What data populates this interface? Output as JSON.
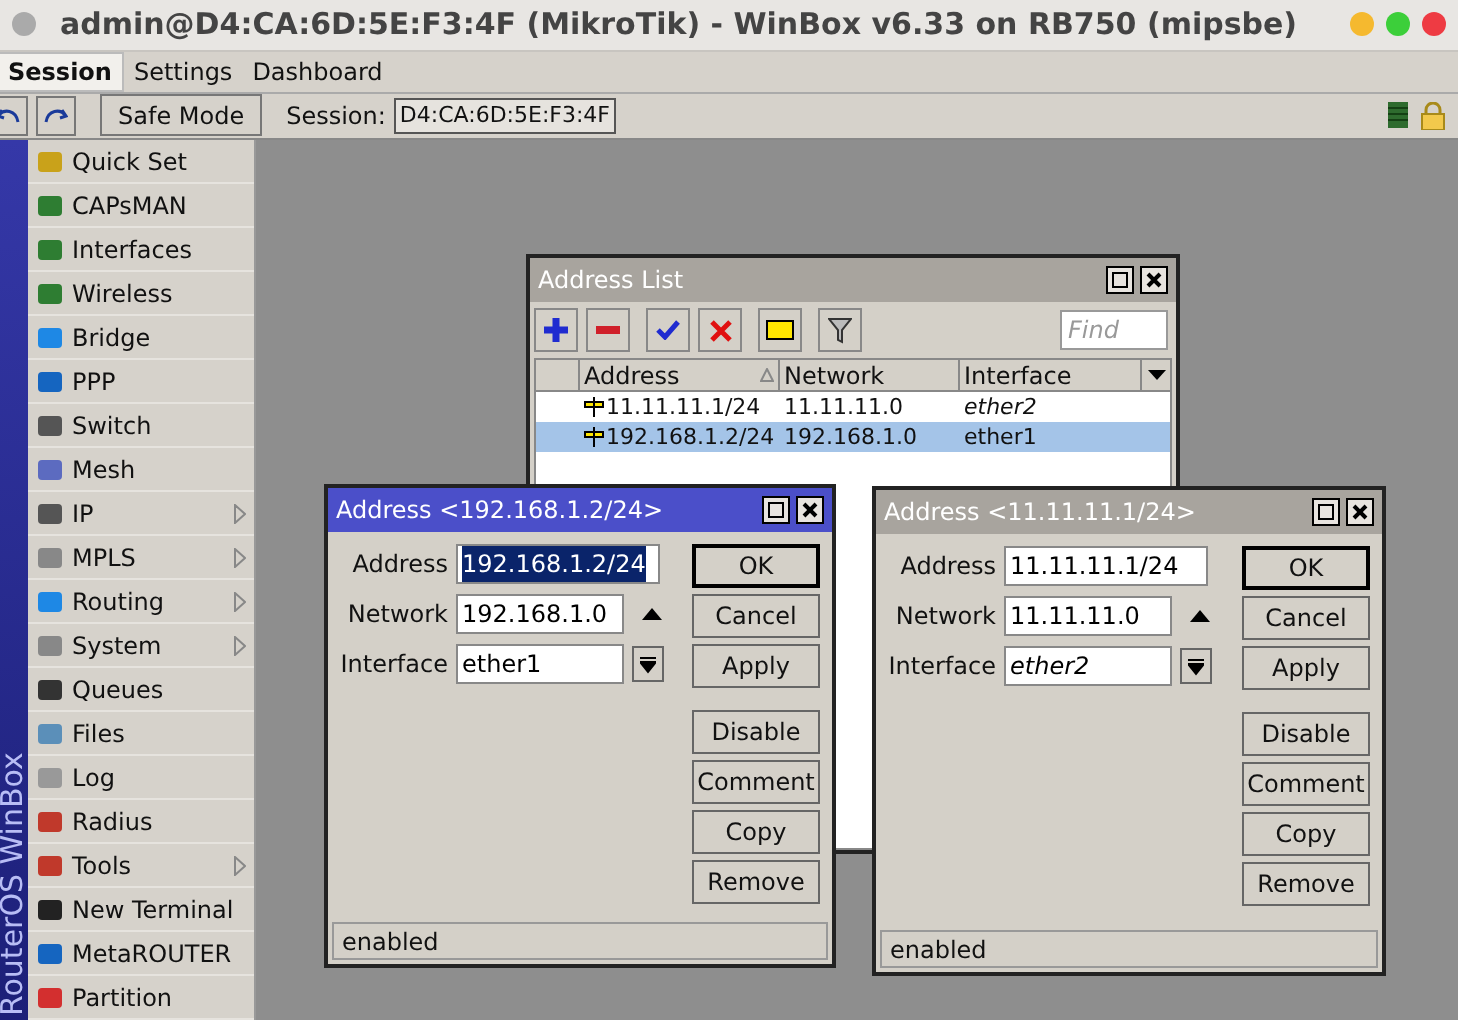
{
  "window": {
    "title": "admin@D4:CA:6D:5E:F3:4F (MikroTik) - WinBox v6.33 on RB750 (mipsbe)"
  },
  "menu": [
    {
      "label": "Session",
      "selected": true
    },
    {
      "label": "Settings",
      "selected": false
    },
    {
      "label": "Dashboard",
      "selected": false
    }
  ],
  "toolbar": {
    "safe_mode": "Safe Mode",
    "session_label": "Session:",
    "session_value": "D4:CA:6D:5E:F3:4F"
  },
  "sidebar": {
    "brand": "RouterOS WinBox",
    "items": [
      {
        "label": "Quick Set",
        "submenu": false
      },
      {
        "label": "CAPsMAN",
        "submenu": false
      },
      {
        "label": "Interfaces",
        "submenu": false
      },
      {
        "label": "Wireless",
        "submenu": false
      },
      {
        "label": "Bridge",
        "submenu": false
      },
      {
        "label": "PPP",
        "submenu": false
      },
      {
        "label": "Switch",
        "submenu": false
      },
      {
        "label": "Mesh",
        "submenu": false
      },
      {
        "label": "IP",
        "submenu": true
      },
      {
        "label": "MPLS",
        "submenu": true
      },
      {
        "label": "Routing",
        "submenu": true
      },
      {
        "label": "System",
        "submenu": true
      },
      {
        "label": "Queues",
        "submenu": false
      },
      {
        "label": "Files",
        "submenu": false
      },
      {
        "label": "Log",
        "submenu": false
      },
      {
        "label": "Radius",
        "submenu": false
      },
      {
        "label": "Tools",
        "submenu": true
      },
      {
        "label": "New Terminal",
        "submenu": false
      },
      {
        "label": "MetaROUTER",
        "submenu": false
      },
      {
        "label": "Partition",
        "submenu": false
      }
    ]
  },
  "address_list": {
    "title": "Address List",
    "find_placeholder": "Find",
    "columns": [
      "Address",
      "Network",
      "Interface"
    ],
    "rows": [
      {
        "address": "11.11.11.1/24",
        "network": "11.11.11.0",
        "interface": "ether2",
        "italic": true,
        "selected": false
      },
      {
        "address": "192.168.1.2/24",
        "network": "192.168.1.0",
        "interface": "ether1",
        "italic": false,
        "selected": true
      }
    ]
  },
  "dialogs": [
    {
      "title": "Address <192.168.1.2/24>",
      "active": true,
      "fields": [
        {
          "label": "Address",
          "value": "192.168.1.2/24",
          "highlighted": true,
          "italic": false,
          "kind": "text"
        },
        {
          "label": "Network",
          "value": "192.168.1.0",
          "highlighted": false,
          "italic": false,
          "kind": "up"
        },
        {
          "label": "Interface",
          "value": "ether1",
          "highlighted": false,
          "italic": false,
          "kind": "dropdown"
        }
      ],
      "buttons": [
        "OK",
        "Cancel",
        "Apply",
        "Disable",
        "Comment",
        "Copy",
        "Remove"
      ],
      "status": "enabled"
    },
    {
      "title": "Address <11.11.11.1/24>",
      "active": false,
      "fields": [
        {
          "label": "Address",
          "value": "11.11.11.1/24",
          "highlighted": false,
          "italic": false,
          "kind": "text"
        },
        {
          "label": "Network",
          "value": "11.11.11.0",
          "highlighted": false,
          "italic": false,
          "kind": "up"
        },
        {
          "label": "Interface",
          "value": "ether2",
          "highlighted": false,
          "italic": true,
          "kind": "dropdown"
        }
      ],
      "buttons": [
        "OK",
        "Cancel",
        "Apply",
        "Disable",
        "Comment",
        "Copy",
        "Remove"
      ],
      "status": "enabled"
    }
  ]
}
